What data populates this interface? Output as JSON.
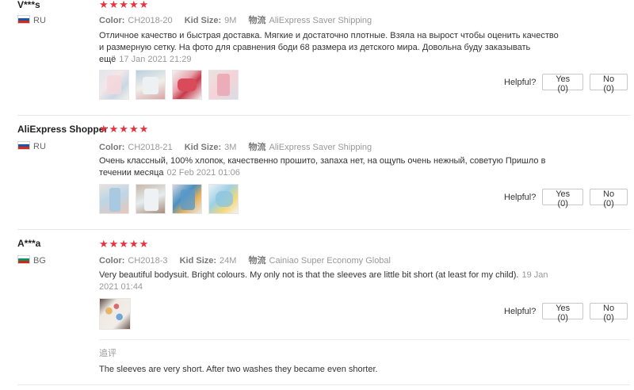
{
  "helpful_label": "Helpful?",
  "colors": {
    "star": "#e8323c",
    "muted": "#999999"
  },
  "labels": {
    "color": "Color:",
    "kid_size": "Kid Size:",
    "shipping": "物流"
  },
  "reviews": [
    {
      "user": "V***s",
      "country": "RU",
      "flag": "ru-flag-icon",
      "stars": "★★★★★",
      "rating": 5,
      "color_value": "CH2018-20",
      "size_value": "9M",
      "shipping_value": "AliExpress Saver Shipping",
      "text": "Отличное качество и быстрая доставка. Мягкие и достаточно плотные. Взяла на вырост чтобы оценить качество и размерную сетку. На фото для сравнения боди 68 размера из детского мира. Довольна буду заказывать ещё",
      "date": "17 Jan 2021 21:29",
      "yes": "Yes (0)",
      "no": "No (0)"
    },
    {
      "user": "AliExpress Shopper",
      "country": "RU",
      "flag": "ru-flag-icon",
      "stars": "★★★★★",
      "rating": 5,
      "color_value": "CH2018-21",
      "size_value": "3M",
      "shipping_value": "AliExpress Saver Shipping",
      "text": "Очень классный, 100% хлопок, качественно прошито, запаха нет, на ощупь очень нежный, советую Пришло в течении месяца",
      "date": "02 Feb 2021 01:06",
      "yes": "Yes (0)",
      "no": "No (0)"
    },
    {
      "user": "A***a",
      "country": "BG",
      "flag": "bg-flag-icon",
      "stars": "★★★★★",
      "rating": 5,
      "color_value": "CH2018-3",
      "size_value": "24M",
      "shipping_value": "Cainiao Super Economy Global",
      "text": "Very beautiful bodysuit. Bright colours. My only not is that the sleeves are little bit short (at least for my child).",
      "date": "19 Jan 2021 01:44",
      "yes": "Yes (0)",
      "no": "No (0)",
      "followup_label": "追评",
      "followup_text": "The sleeves are very short. After two washes they became even shorter."
    }
  ]
}
